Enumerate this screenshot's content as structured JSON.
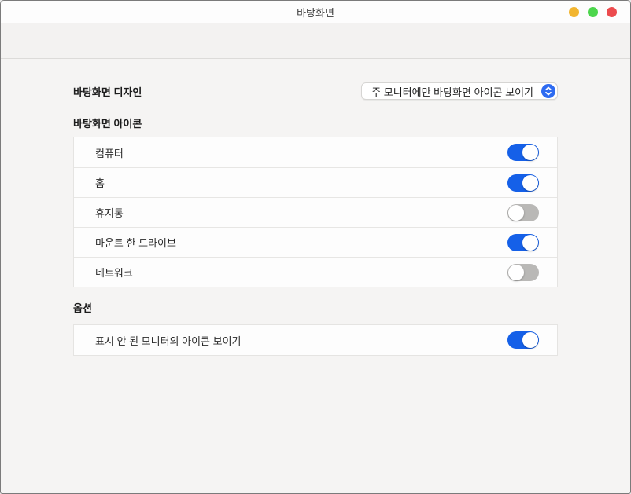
{
  "window": {
    "title": "바탕화면"
  },
  "titlebar_buttons": {
    "minimize_color": "#f2b52f",
    "maximize_color": "#4cd64c",
    "close_color": "#ec4b4e"
  },
  "design": {
    "label": "바탕화면 디자인",
    "dropdown_value": "주 모니터에만 바탕화면 아이콘 보이기"
  },
  "icons_section": {
    "label": "바탕화면 아이콘",
    "rows": [
      {
        "label": "컴퓨터",
        "on": true
      },
      {
        "label": "홈",
        "on": true
      },
      {
        "label": "휴지통",
        "on": false
      },
      {
        "label": "마운트 한 드라이브",
        "on": true
      },
      {
        "label": "네트워크",
        "on": false
      }
    ]
  },
  "options_section": {
    "label": "옵션",
    "rows": [
      {
        "label": "표시 안 된 모니터의 아이콘 보이기",
        "on": true
      }
    ]
  },
  "colors": {
    "toggle_on": "#1560e8",
    "toggle_off": "#b9b8b6",
    "dropdown_accent": "#2e6bf1"
  }
}
